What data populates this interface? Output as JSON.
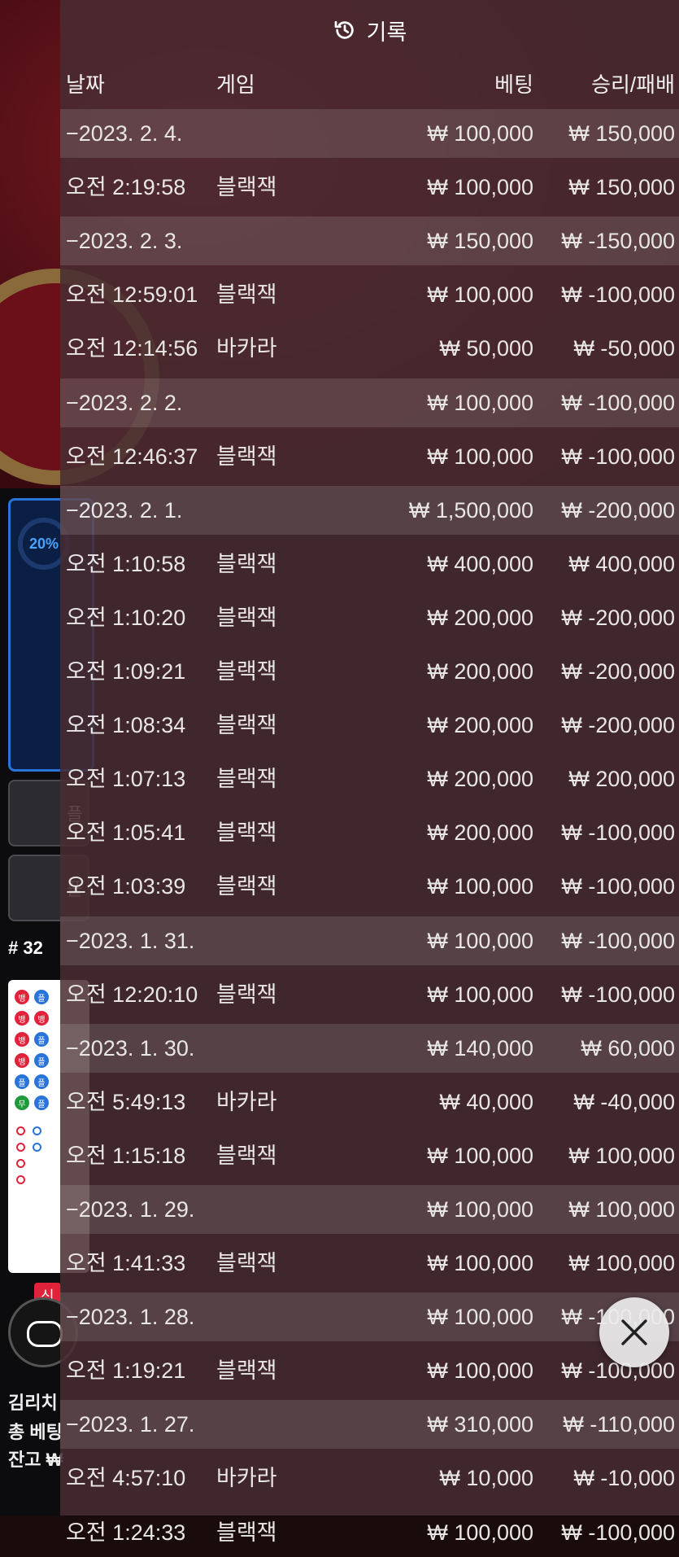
{
  "panel": {
    "title": "기록",
    "title_icon": "history-icon"
  },
  "columns": {
    "date": "날짜",
    "game": "게임",
    "bet": "베팅",
    "result": "승리/패배"
  },
  "rows": [
    {
      "type": "date",
      "date": "−2023. 2. 4.",
      "game": "",
      "bet": "₩ 100,000",
      "result": "₩ 150,000"
    },
    {
      "type": "entry",
      "date": "오전 2:19:58",
      "game": "블랙잭",
      "bet": "₩ 100,000",
      "result": "₩ 150,000"
    },
    {
      "type": "date",
      "date": "−2023. 2. 3.",
      "game": "",
      "bet": "₩ 150,000",
      "result": "₩ -150,000"
    },
    {
      "type": "entry",
      "date": "오전 12:59:01",
      "game": "블랙잭",
      "bet": "₩ 100,000",
      "result": "₩ -100,000"
    },
    {
      "type": "entry",
      "date": "오전 12:14:56",
      "game": "바카라",
      "bet": "₩ 50,000",
      "result": "₩ -50,000"
    },
    {
      "type": "date",
      "date": "−2023. 2. 2.",
      "game": "",
      "bet": "₩ 100,000",
      "result": "₩ -100,000"
    },
    {
      "type": "entry",
      "date": "오전 12:46:37",
      "game": "블랙잭",
      "bet": "₩ 100,000",
      "result": "₩ -100,000"
    },
    {
      "type": "date",
      "date": "−2023. 2. 1.",
      "game": "",
      "bet": "₩ 1,500,000",
      "result": "₩ -200,000"
    },
    {
      "type": "entry",
      "date": "오전 1:10:58",
      "game": "블랙잭",
      "bet": "₩ 400,000",
      "result": "₩ 400,000"
    },
    {
      "type": "entry",
      "date": "오전 1:10:20",
      "game": "블랙잭",
      "bet": "₩ 200,000",
      "result": "₩ -200,000"
    },
    {
      "type": "entry",
      "date": "오전 1:09:21",
      "game": "블랙잭",
      "bet": "₩ 200,000",
      "result": "₩ -200,000"
    },
    {
      "type": "entry",
      "date": "오전 1:08:34",
      "game": "블랙잭",
      "bet": "₩ 200,000",
      "result": "₩ -200,000"
    },
    {
      "type": "entry",
      "date": "오전 1:07:13",
      "game": "블랙잭",
      "bet": "₩ 200,000",
      "result": "₩ 200,000"
    },
    {
      "type": "entry",
      "date": "오전 1:05:41",
      "game": "블랙잭",
      "bet": "₩ 200,000",
      "result": "₩ -100,000"
    },
    {
      "type": "entry",
      "date": "오전 1:03:39",
      "game": "블랙잭",
      "bet": "₩ 100,000",
      "result": "₩ -100,000"
    },
    {
      "type": "date",
      "date": "−2023. 1. 31.",
      "game": "",
      "bet": "₩ 100,000",
      "result": "₩ -100,000"
    },
    {
      "type": "entry",
      "date": "오전 12:20:10",
      "game": "블랙잭",
      "bet": "₩ 100,000",
      "result": "₩ -100,000"
    },
    {
      "type": "date",
      "date": "−2023. 1. 30.",
      "game": "",
      "bet": "₩ 140,000",
      "result": "₩ 60,000"
    },
    {
      "type": "entry",
      "date": "오전 5:49:13",
      "game": "바카라",
      "bet": "₩ 40,000",
      "result": "₩ -40,000"
    },
    {
      "type": "entry",
      "date": "오전 1:15:18",
      "game": "블랙잭",
      "bet": "₩ 100,000",
      "result": "₩ 100,000"
    },
    {
      "type": "date",
      "date": "−2023. 1. 29.",
      "game": "",
      "bet": "₩ 100,000",
      "result": "₩ 100,000"
    },
    {
      "type": "entry",
      "date": "오전 1:41:33",
      "game": "블랙잭",
      "bet": "₩ 100,000",
      "result": "₩ 100,000"
    },
    {
      "type": "date",
      "date": "−2023. 1. 28.",
      "game": "",
      "bet": "₩ 100,000",
      "result": "₩ -100,000"
    },
    {
      "type": "entry",
      "date": "오전 1:19:21",
      "game": "블랙잭",
      "bet": "₩ 100,000",
      "result": "₩ -100,000"
    },
    {
      "type": "date",
      "date": "−2023. 1. 27.",
      "game": "",
      "bet": "₩ 310,000",
      "result": "₩ -110,000"
    },
    {
      "type": "entry",
      "date": "오전 4:57:10",
      "game": "바카라",
      "bet": "₩ 10,000",
      "result": "₩ -10,000"
    },
    {
      "type": "entry",
      "date": "오전 1:24:33",
      "game": "블랙잭",
      "bet": "₩ 100,000",
      "result": "₩ -100,000"
    }
  ],
  "background": {
    "progress_text": "20%",
    "round_id": "# 32",
    "new_tag": "신",
    "player_name": "김리치",
    "total_bet_label": "총 베팅",
    "balance_label": "잔고 ₩"
  },
  "close_button": {
    "icon": "close-icon"
  },
  "colors": {
    "panel_bg": "#4a2c32",
    "date_row_highlight": "#6a545a",
    "text": "#e9e6e6"
  }
}
